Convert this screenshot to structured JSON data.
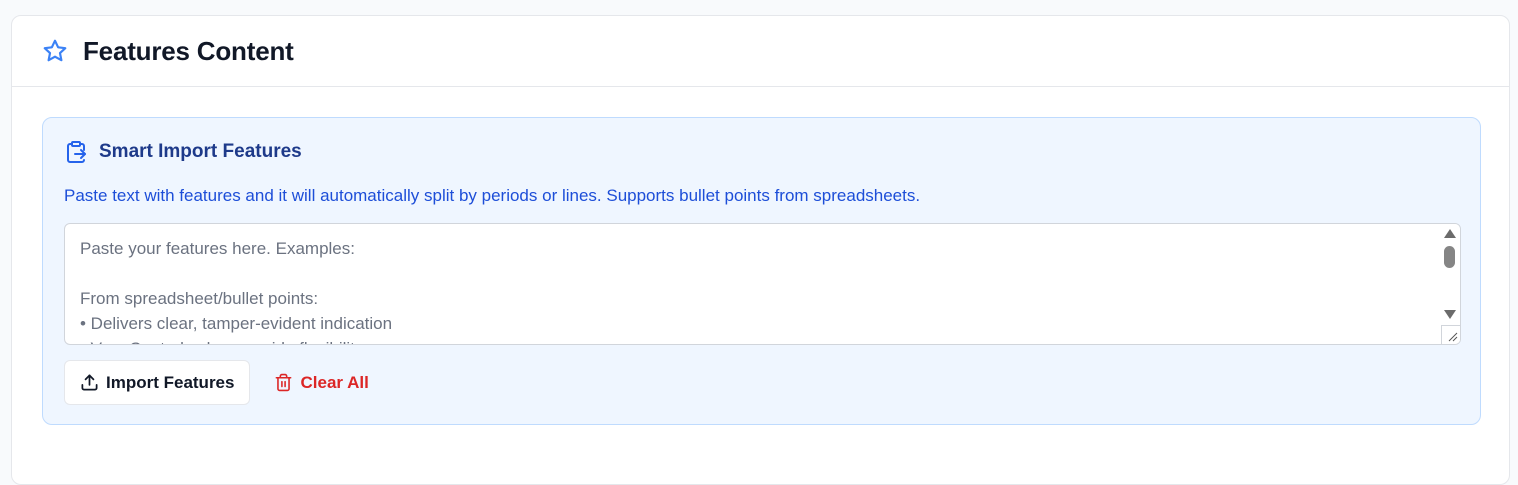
{
  "header": {
    "title": "Features Content",
    "icon": "star-icon",
    "icon_color": "#3b82f6"
  },
  "import_panel": {
    "title": "Smart Import Features",
    "icon": "clipboard-import-icon",
    "description": "Paste text with features and it will automatically split by periods or lines. Supports bullet points from spreadsheets.",
    "textarea": {
      "value": "",
      "placeholder": "Paste your features here. Examples:\n\nFrom spreadsheet/bullet points:\n• Delivers clear, tamper-evident indication\n• Vary Control colors provide flexibility"
    },
    "import_button": {
      "label": "Import Features",
      "icon": "upload-icon"
    },
    "clear_button": {
      "label": "Clear All",
      "icon": "trash-icon",
      "color": "#dc2626"
    },
    "accent_color": "#1d4ed8",
    "background": "#eff6ff"
  }
}
